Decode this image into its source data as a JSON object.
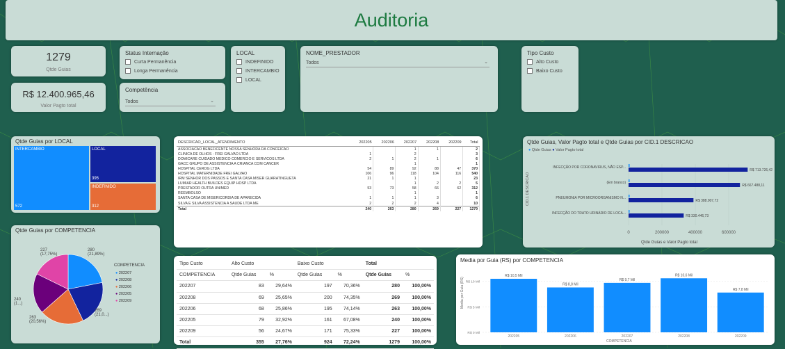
{
  "title": "Auditoria",
  "kpis": {
    "qtde_value": "1279",
    "qtde_label": "Qtde Guias",
    "valor_value": "R$ 12.400.965,46",
    "valor_label": "Valor Pagto total"
  },
  "slicers": {
    "status": {
      "title": "Status Internação",
      "options": [
        "Curta Permanência",
        "Longa Permanência"
      ]
    },
    "local": {
      "title": "LOCAL",
      "options": [
        "INDEFINIDO",
        "INTERCAMBIO",
        "LOCAL"
      ]
    },
    "prestador": {
      "title": "NOME_PRESTADOR",
      "selected": "Todos"
    },
    "tipo_custo": {
      "title": "Tipo Custo",
      "options": [
        "Alto Custo",
        "Baixo Custo"
      ]
    },
    "competencia": {
      "title": "Competência",
      "selected": "Todos"
    }
  },
  "treemap": {
    "title": "Qtde Guias por LOCAL",
    "items": [
      {
        "label": "INTERCAMBIO",
        "value": "572",
        "color": "#118dff"
      },
      {
        "label": "LOCAL",
        "value": "395",
        "color": "#12239e"
      },
      {
        "label": "INDEFINIDO",
        "value": "312",
        "color": "#e66c37"
      }
    ]
  },
  "pie": {
    "title": "Qtde Guias por COMPETENCIA",
    "legend_title": "COMPETENCIA",
    "labels": [
      "227 (17,75%)",
      "280 (21,89%)",
      "269 (21,0...)",
      "263 (20,56%)",
      "240 (1...)"
    ]
  },
  "matrix": {
    "headers": [
      "DESCRICAO_LOCAL_ATENDIMENTO",
      "202205",
      "202206",
      "202207",
      "202208",
      "202209",
      "Total"
    ],
    "rows": [
      [
        "ASSOCIACAO BENEFICENTE NOSSA SENHORA DA CONCEICAO",
        "",
        "",
        "1",
        "1",
        "",
        "2"
      ],
      [
        "CLINICA DE OLHOS - FREI GALVAO LTDA",
        "1",
        "",
        "2",
        "",
        "",
        "3"
      ],
      [
        "DOMICARE CUIDADO MEDICO COMERCIO E SERVICOS LTDA",
        "2",
        "1",
        "2",
        "1",
        "",
        "6"
      ],
      [
        "GACC GRUPO DE ASSISTENCIA A CRIANCA COM CANCER",
        "",
        "",
        "1",
        "",
        "",
        "1"
      ],
      [
        "HOSPITAL CEROG LTDA",
        "54",
        "89",
        "92",
        "88",
        "47",
        "370"
      ],
      [
        "HOSPITAL MATERNIDADE FREI GALVAO",
        "106",
        "96",
        "118",
        "104",
        "116",
        "540"
      ],
      [
        "IRM SENHOR DOS PASSOS E SANTA CASA MISER GUARATINGUETA",
        "21",
        "1",
        "1",
        "",
        "",
        "23"
      ],
      [
        "LUMIAR HEALTH BUILDES EQUIP HOSP LTDA",
        "",
        "",
        "1",
        "2",
        "2",
        "5"
      ],
      [
        "PRESTADOR OUTRA UNIMED",
        "53",
        "73",
        "58",
        "66",
        "62",
        "312"
      ],
      [
        "REEMBOLSO",
        "",
        "",
        "1",
        "",
        "",
        "1"
      ],
      [
        "SANTA CASA DE MISERICORDIA DE APARECIDA",
        "1",
        "1",
        "1",
        "3",
        "",
        "6"
      ],
      [
        "SILVA E SILVA ASSISTENCIA A SAUDE LTDA ME",
        "2",
        "2",
        "2",
        "4",
        "",
        "10"
      ],
      [
        "Total",
        "240",
        "263",
        "280",
        "269",
        "227",
        "1279"
      ]
    ]
  },
  "cid": {
    "title": "Qtde Guias, Valor Pagto total e Qtde Guias por CID.1 DESCRICAO",
    "legend": [
      "Qtde Guias",
      "Valor Pagto total"
    ],
    "ylabel": "CID.1 DESCRICAO",
    "xlabel": "Qtde Guias e Valor Pagto total",
    "categories": [
      "INFECÇÃO POR CORONAVIRUS, NÃO ESP...",
      "(Em branco)",
      "PNEUMONIA POR MICROORGANISMO N...",
      "INFECÇÃO DO TRATO URINÁRIO DE LOCA..."
    ],
    "bar_labels": [
      "R$ 713.726,42",
      "R$ 667.488,11",
      "R$ 388.907,72",
      "R$ 330.446,73"
    ],
    "ticks": [
      "0",
      "200000",
      "400000",
      "600000"
    ]
  },
  "custo_table": {
    "header1": [
      "Tipo Custo",
      "Alto Custo",
      "",
      "Baixo Custo",
      "",
      "Total",
      ""
    ],
    "header2": [
      "COMPETENCIA",
      "Qtde Guias",
      "%",
      "Qtde Guias",
      "%",
      "Qtde Guias",
      "%"
    ],
    "rows": [
      [
        "202207",
        "83",
        "29,64%",
        "197",
        "70,36%",
        "280",
        "100,00%"
      ],
      [
        "202208",
        "69",
        "25,65%",
        "200",
        "74,35%",
        "269",
        "100,00%"
      ],
      [
        "202206",
        "68",
        "25,86%",
        "195",
        "74,14%",
        "263",
        "100,00%"
      ],
      [
        "202205",
        "79",
        "32,92%",
        "161",
        "67,08%",
        "240",
        "100,00%"
      ],
      [
        "202209",
        "56",
        "24,67%",
        "171",
        "75,33%",
        "227",
        "100,00%"
      ],
      [
        "Total",
        "355",
        "27,76%",
        "924",
        "72,24%",
        "1279",
        "100,00%"
      ]
    ]
  },
  "media": {
    "title": "Media por Guia (RS) por COMPETENCIA",
    "ylabel": "Media por Guia (RS)",
    "xlabel": "COMPETENCIA",
    "yticks": [
      "R$ 0 Mil",
      "R$ 5 Mil",
      "R$ 10 Mil"
    ],
    "categories": [
      "202205",
      "202206",
      "202207",
      "202208",
      "202209"
    ],
    "labels": [
      "R$ 10,5 Mil",
      "R$ 8,8 Mil",
      "R$ 9,7 Mil",
      "R$ 10,6 Mil",
      "R$ 7,8 Mil"
    ],
    "color": "#118dff"
  },
  "chart_data": [
    {
      "type": "bar",
      "title": "Media por Guia (RS) por COMPETENCIA",
      "xlabel": "COMPETENCIA",
      "ylabel": "Media por Guia (RS)",
      "categories": [
        "202205",
        "202206",
        "202207",
        "202208",
        "202209"
      ],
      "values": [
        10.5,
        8.8,
        9.7,
        10.6,
        7.8
      ],
      "unit": "R$ Mil",
      "ylim": [
        0,
        12
      ]
    },
    {
      "type": "pie",
      "title": "Qtde Guias por COMPETENCIA",
      "categories": [
        "202207",
        "202208",
        "202206",
        "202205",
        "202209"
      ],
      "values": [
        280,
        269,
        263,
        240,
        227
      ],
      "colors": [
        "#118dff",
        "#12239e",
        "#e66c37",
        "#6b007b",
        "#e044a7"
      ]
    },
    {
      "type": "bar",
      "orientation": "horizontal",
      "title": "Qtde Guias, Valor Pagto total e Qtde Guias por CID.1 DESCRICAO",
      "categories": [
        "INFECÇÃO POR CORONAVIRUS, NÃO ESP...",
        "(Em branco)",
        "PNEUMONIA POR MICROORGANISMO N...",
        "INFECÇÃO DO TRATO URINÁRIO DE LOCA..."
      ],
      "series": [
        {
          "name": "Valor Pagto total",
          "values": [
            713726.42,
            667488.11,
            388907.72,
            330446.73
          ]
        }
      ],
      "xlim": [
        0,
        700000
      ]
    },
    {
      "type": "treemap",
      "title": "Qtde Guias por LOCAL",
      "categories": [
        "INTERCAMBIO",
        "LOCAL",
        "INDEFINIDO"
      ],
      "values": [
        572,
        395,
        312
      ]
    }
  ]
}
